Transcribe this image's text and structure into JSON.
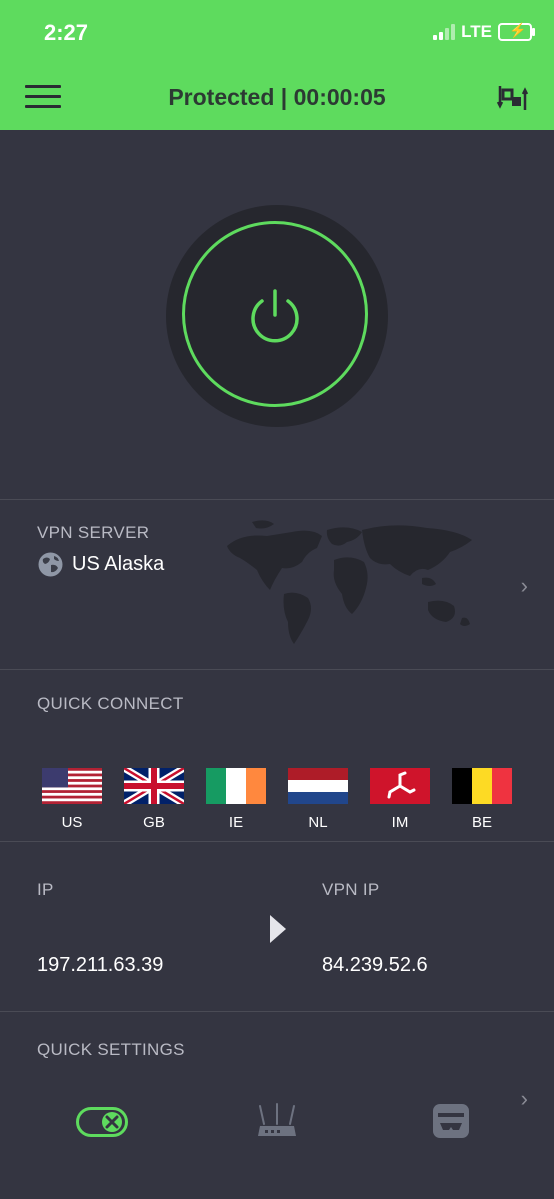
{
  "status_bar": {
    "time": "2:27",
    "network": "LTE"
  },
  "header": {
    "title": "Protected | 00:00:05"
  },
  "vpn_server": {
    "label": "VPN SERVER",
    "name": "US Alaska"
  },
  "quick_connect": {
    "label": "QUICK CONNECT",
    "countries": [
      {
        "code": "US"
      },
      {
        "code": "GB"
      },
      {
        "code": "IE"
      },
      {
        "code": "NL"
      },
      {
        "code": "IM"
      },
      {
        "code": "BE"
      }
    ]
  },
  "ip_info": {
    "ip_label": "IP",
    "ip_value": "197.211.63.39",
    "vpn_ip_label": "VPN IP",
    "vpn_ip_value": "84.239.52.6"
  },
  "quick_settings": {
    "label": "QUICK SETTINGS",
    "icons": [
      "kill-switch-toggle-icon",
      "router-icon",
      "incognito-card-icon"
    ]
  },
  "colors": {
    "accent": "#5edb5e",
    "background": "#343541",
    "header_text": "#2c3a33"
  }
}
